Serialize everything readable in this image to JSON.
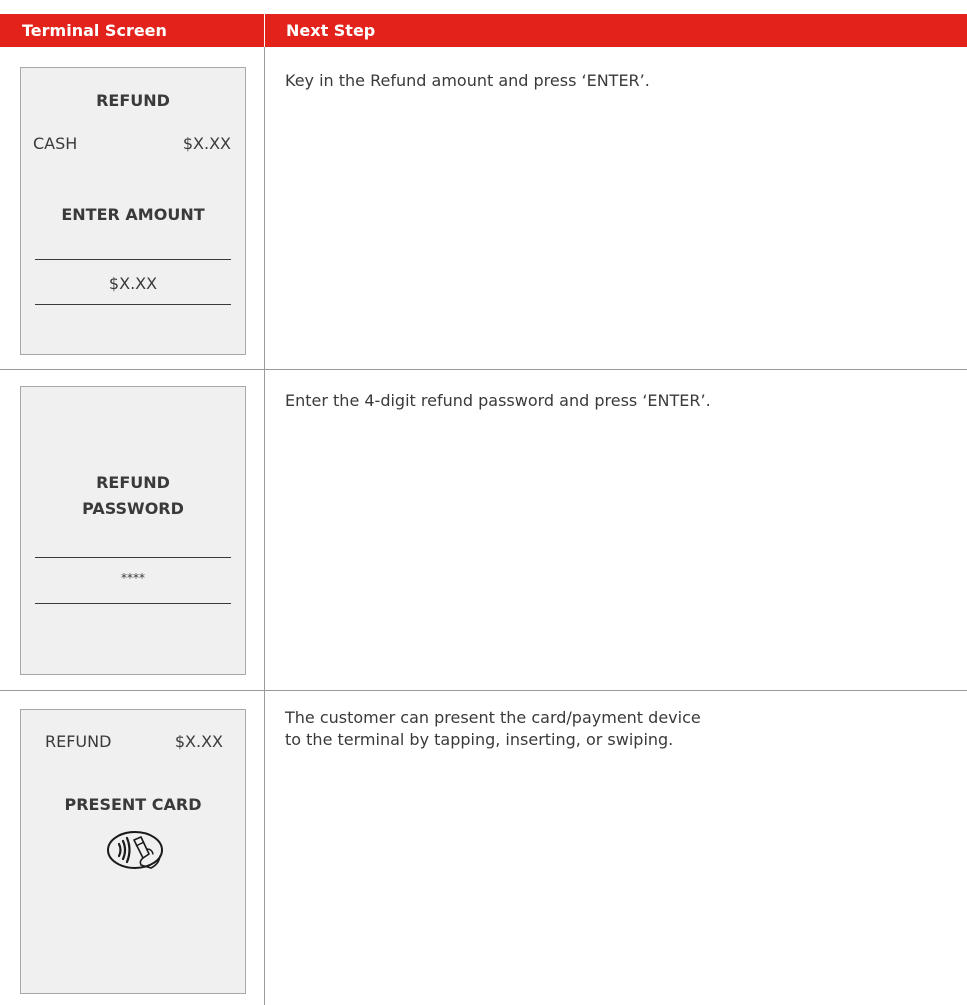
{
  "header": {
    "col1_label": "Terminal Screen",
    "col2_label": "Next Step",
    "color": "#e3231b"
  },
  "rows": [
    {
      "screen": {
        "title": "REFUND",
        "line_left": "CASH",
        "line_right": "$X.XX",
        "prompt": "ENTER AMOUNT",
        "field_value": "$X.XX"
      },
      "step": "Key in the Refund amount and press ‘ENTER’."
    },
    {
      "screen": {
        "title_line1": "REFUND",
        "title_line2": "PASSWORD",
        "field_value": "****"
      },
      "step": "Enter the 4-digit refund password and press ‘ENTER’."
    },
    {
      "screen": {
        "line_left": "REFUND",
        "line_right": "$X.XX",
        "prompt": "PRESENT CARD",
        "icon": "contactless-card-icon"
      },
      "step_line1": "The customer can present the card/payment device",
      "step_line2": "to the terminal by tapping, inserting, or swiping."
    }
  ]
}
